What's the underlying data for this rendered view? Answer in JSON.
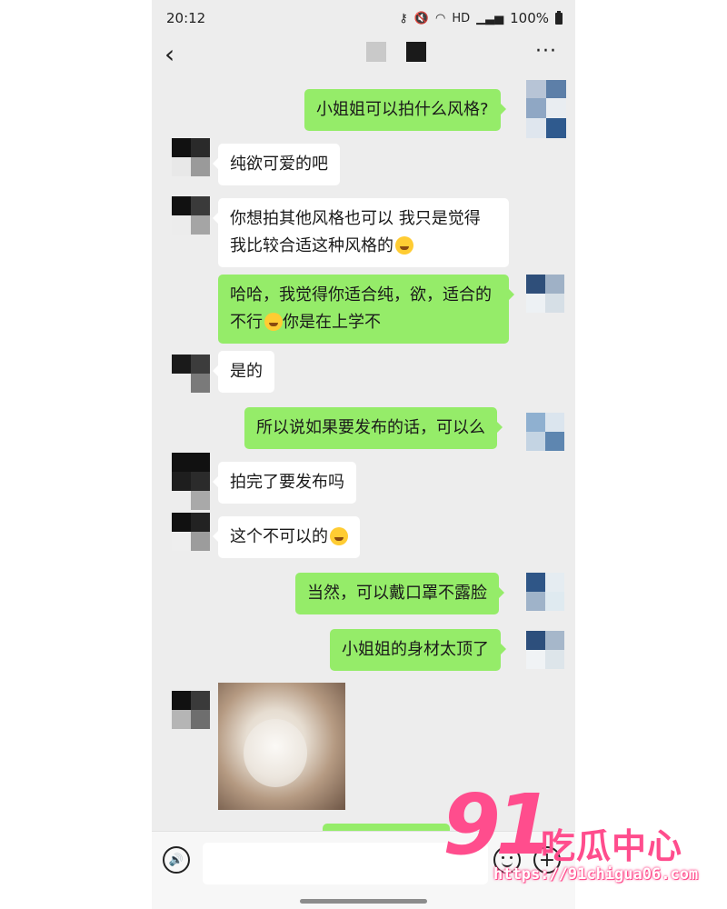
{
  "status_bar": {
    "time": "20:12",
    "icons": [
      "key-icon",
      "mute-icon",
      "wifi-icon",
      "hd-icon",
      "signal-icon"
    ],
    "hd": "HD",
    "battery": "100%"
  },
  "nav": {
    "back_icon": "chevron-left-icon",
    "more": "···"
  },
  "colors": {
    "chat_background": "#ededed",
    "outgoing_bubble": "#95ec69",
    "incoming_bubble": "#ffffff",
    "watermark": "#ff4d8d"
  },
  "messages": [
    {
      "side": "out",
      "text": "小姐姐可以拍什么风格?"
    },
    {
      "side": "in",
      "text": "纯欲可爱的吧"
    },
    {
      "side": "in",
      "line1": "你想拍其他风格也可以 我只是觉得",
      "line2": "我比较合适这种风格的",
      "emoji": "grin-emoji"
    },
    {
      "side": "out",
      "line1": "哈哈，我觉得你适合纯，欲，适合的",
      "line2_pre": "不行",
      "emoji": "laugh-cry-emoji",
      "line2_post": "你是在上学不"
    },
    {
      "side": "in",
      "text": "是的"
    },
    {
      "side": "out",
      "text": "所以说如果要发布的话，可以么"
    },
    {
      "side": "in",
      "text": "拍完了要发布吗"
    },
    {
      "side": "in",
      "text": "这个不可以的",
      "emoji": "flushed-emoji"
    },
    {
      "side": "out",
      "text": "当然，可以戴口罩不露脸"
    },
    {
      "side": "out",
      "text": "小姐姐的身材太顶了"
    },
    {
      "side": "in",
      "type": "image"
    }
  ],
  "input_bar": {
    "voice_icon": "voice-icon",
    "emoji_icon": "emoji-icon",
    "plus_icon": "plus-icon",
    "plus": "+",
    "voice": "🔊"
  },
  "watermark": {
    "number": "91",
    "text": "吃瓜中心",
    "url": "https://91chigua06.com"
  }
}
